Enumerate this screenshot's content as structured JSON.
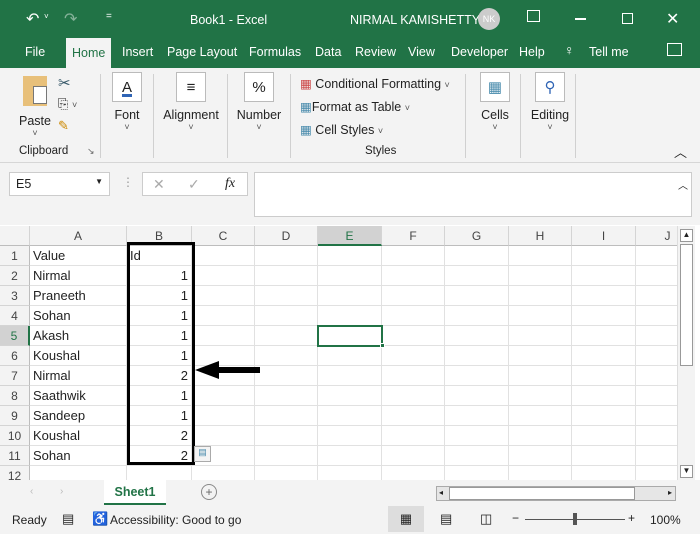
{
  "title_bar": {
    "doc_title": "Book1  -  Excel",
    "user_name": "NIRMAL KAMISHETTY",
    "user_initials": "NK"
  },
  "tabs": [
    "File",
    "Home",
    "Insert",
    "Page Layout",
    "Formulas",
    "Data",
    "Review",
    "View",
    "Developer",
    "Help",
    "Tell me"
  ],
  "ribbon": {
    "paste": "Paste",
    "clipboard": "Clipboard",
    "font": "Font",
    "alignment": "Alignment",
    "number": "Number",
    "conditional_formatting": "Conditional Formatting",
    "format_as_table": "Format as Table",
    "cell_styles": "Cell Styles",
    "styles": "Styles",
    "cells": "Cells",
    "editing": "Editing"
  },
  "formula_bar": {
    "name_box": "E5",
    "fx": "fx",
    "value": ""
  },
  "columns": [
    "A",
    "B",
    "C",
    "D",
    "E",
    "F",
    "G",
    "H",
    "I",
    "J"
  ],
  "rows": [
    [
      "Value",
      "Id"
    ],
    [
      "Nirmal",
      "1"
    ],
    [
      "Praneeth",
      "1"
    ],
    [
      "Sohan",
      "1"
    ],
    [
      "Akash",
      "1"
    ],
    [
      "Koushal",
      "1"
    ],
    [
      "Nirmal",
      "2"
    ],
    [
      "Saathwik",
      "1"
    ],
    [
      "Sandeep",
      "1"
    ],
    [
      "Koushal",
      "2"
    ],
    [
      "Sohan",
      "2"
    ],
    [
      "",
      ""
    ]
  ],
  "selected_cell": "E5",
  "sheet_tab": "Sheet1",
  "status": {
    "ready": "Ready",
    "accessibility": "Accessibility: Good to go",
    "zoom": "100%"
  },
  "accent": "#217346"
}
